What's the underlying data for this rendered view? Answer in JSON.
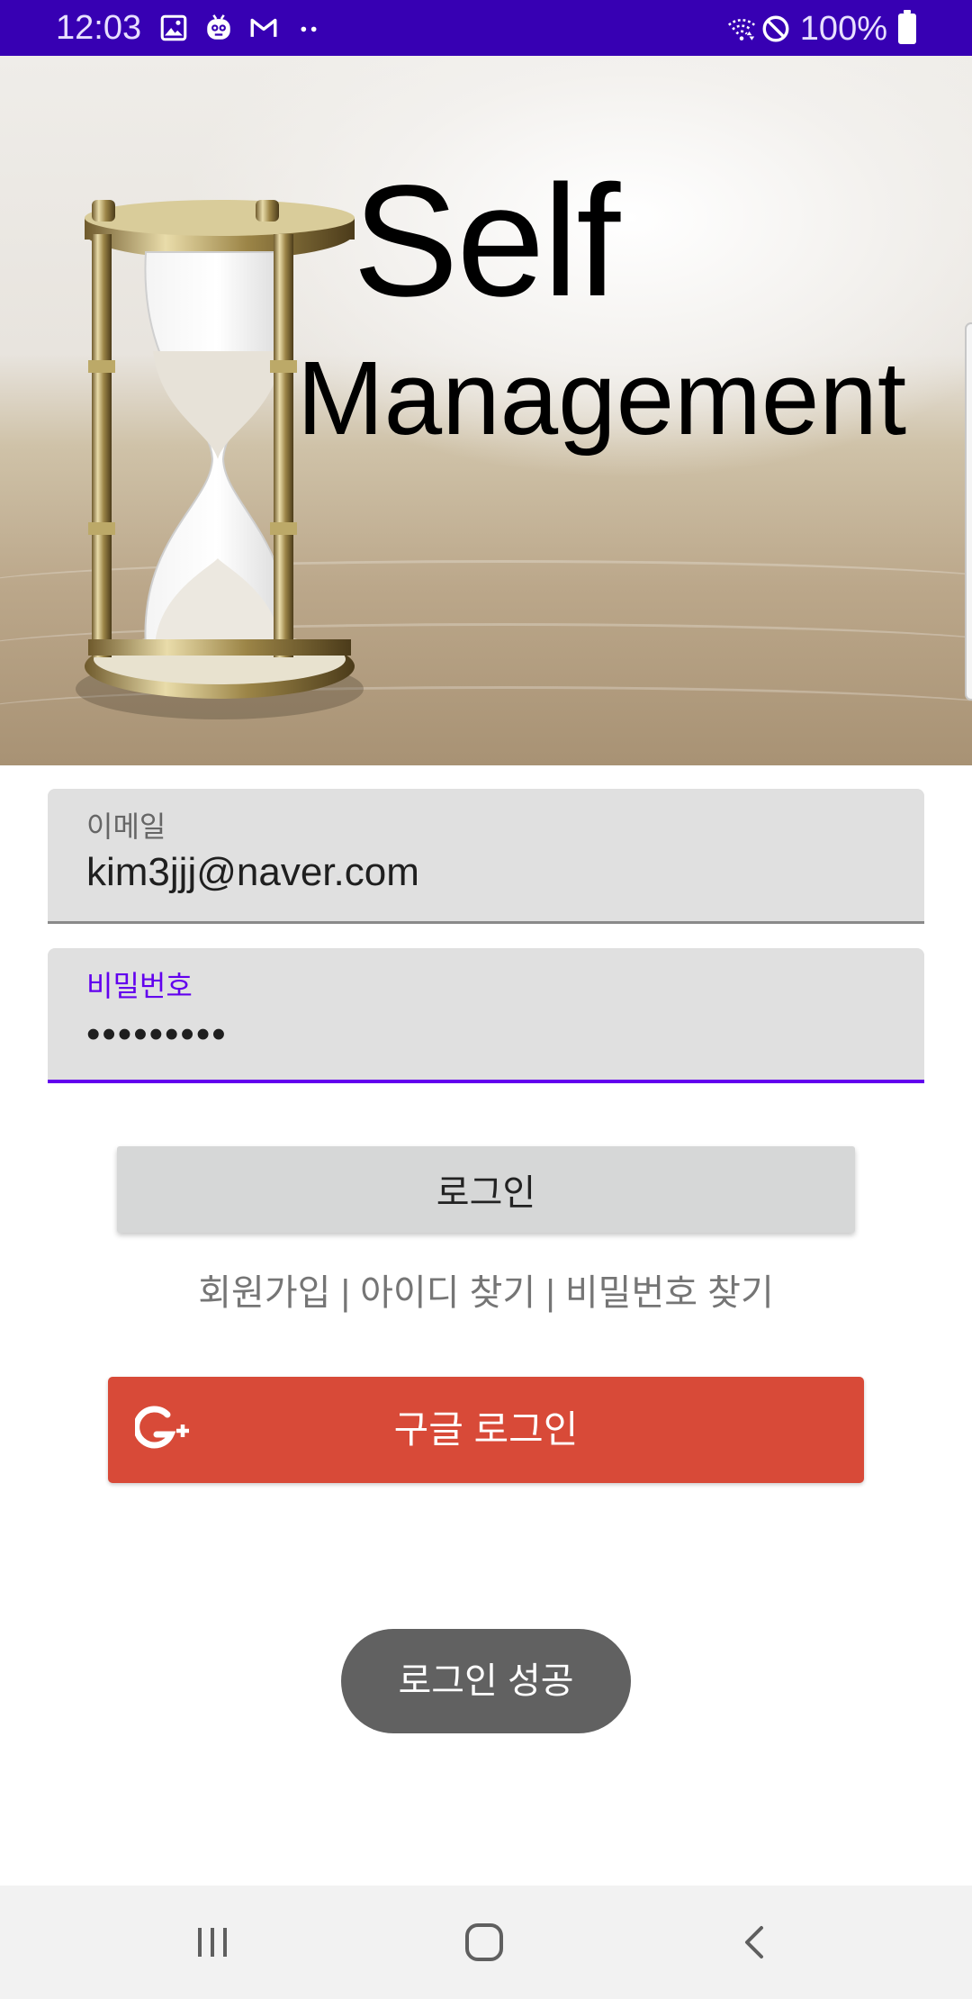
{
  "status_bar": {
    "time": "12:03",
    "battery_text": "100%",
    "left_icons": [
      "image-icon",
      "robot-face-icon",
      "gmail-icon",
      "more-dots-icon"
    ],
    "right_icons": [
      "wifi-icon",
      "do-not-disturb-icon",
      "battery-icon"
    ],
    "color": "#3700b3"
  },
  "hero": {
    "title_line1": "Self",
    "title_line2": "Management",
    "image": "hourglass-on-sand"
  },
  "form": {
    "email": {
      "label": "이메일",
      "value": "kim3jjj@naver.com"
    },
    "password": {
      "label": "비밀번호",
      "masked_value": "•••••••••",
      "focused": true,
      "accent_color": "#6200ee"
    }
  },
  "login_button": {
    "label": "로그인"
  },
  "links": {
    "signup": "회원가입",
    "find_id": "아이디 찾기",
    "find_password": "비밀번호 찾기",
    "separator": "|"
  },
  "google_button": {
    "label": "구글 로그인",
    "icon": "google-plus-icon",
    "color": "#d84a38"
  },
  "toast": {
    "message": "로그인 성공"
  },
  "nav_bar": {
    "buttons": [
      "recent-apps-icon",
      "home-icon",
      "back-icon"
    ]
  }
}
